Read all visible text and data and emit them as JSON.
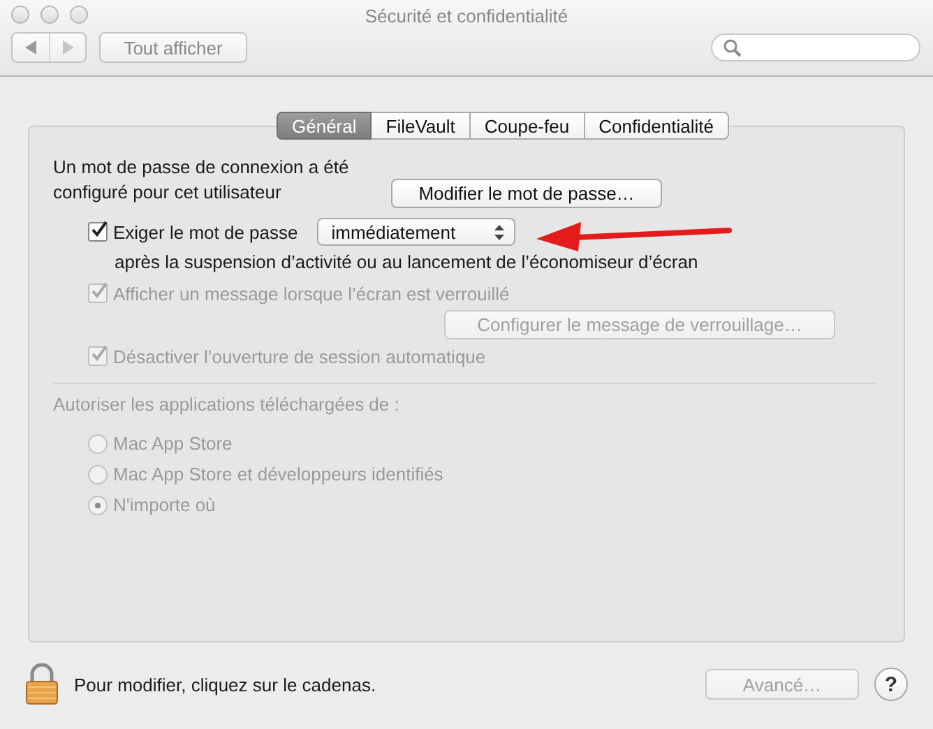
{
  "window": {
    "title": "Sécurité et confidentialité"
  },
  "toolbar": {
    "show_all": "Tout afficher"
  },
  "tabs": [
    {
      "label": "Général",
      "selected": true
    },
    {
      "label": "FileVault",
      "selected": false
    },
    {
      "label": "Coupe-feu",
      "selected": false
    },
    {
      "label": "Confidentialité",
      "selected": false
    }
  ],
  "password_note": "Un mot de passe de connexion a été configuré pour cet utilisateur",
  "change_password_button": "Modifier le mot de passe…",
  "require_password": {
    "label": "Exiger le mot de passe",
    "checked": true,
    "disabled": false,
    "delay": "immédiatement",
    "note": "après la suspension d’activité ou au lancement de l’économiseur d’écran"
  },
  "show_message": {
    "label": "Afficher un message lorsque l’écran est verrouillé",
    "checked": true,
    "disabled": true
  },
  "configure_message_button": {
    "label": "Configurer le message de verrouillage…",
    "disabled": true
  },
  "disable_auto_login": {
    "label": "Désactiver l’ouverture de session automatique",
    "checked": true,
    "disabled": true
  },
  "downloads": {
    "label": "Autoriser les applications téléchargées de :",
    "disabled": true,
    "options": [
      {
        "label": "Mac App Store",
        "selected": false
      },
      {
        "label": "Mac App Store et développeurs identifiés",
        "selected": false
      },
      {
        "label": "N'importe où",
        "selected": true
      }
    ]
  },
  "lock": {
    "locked": true,
    "message": "Pour modifier, cliquez sur le cadenas."
  },
  "advanced_button": {
    "label": "Avancé…",
    "disabled": true
  },
  "help_button": "?"
}
